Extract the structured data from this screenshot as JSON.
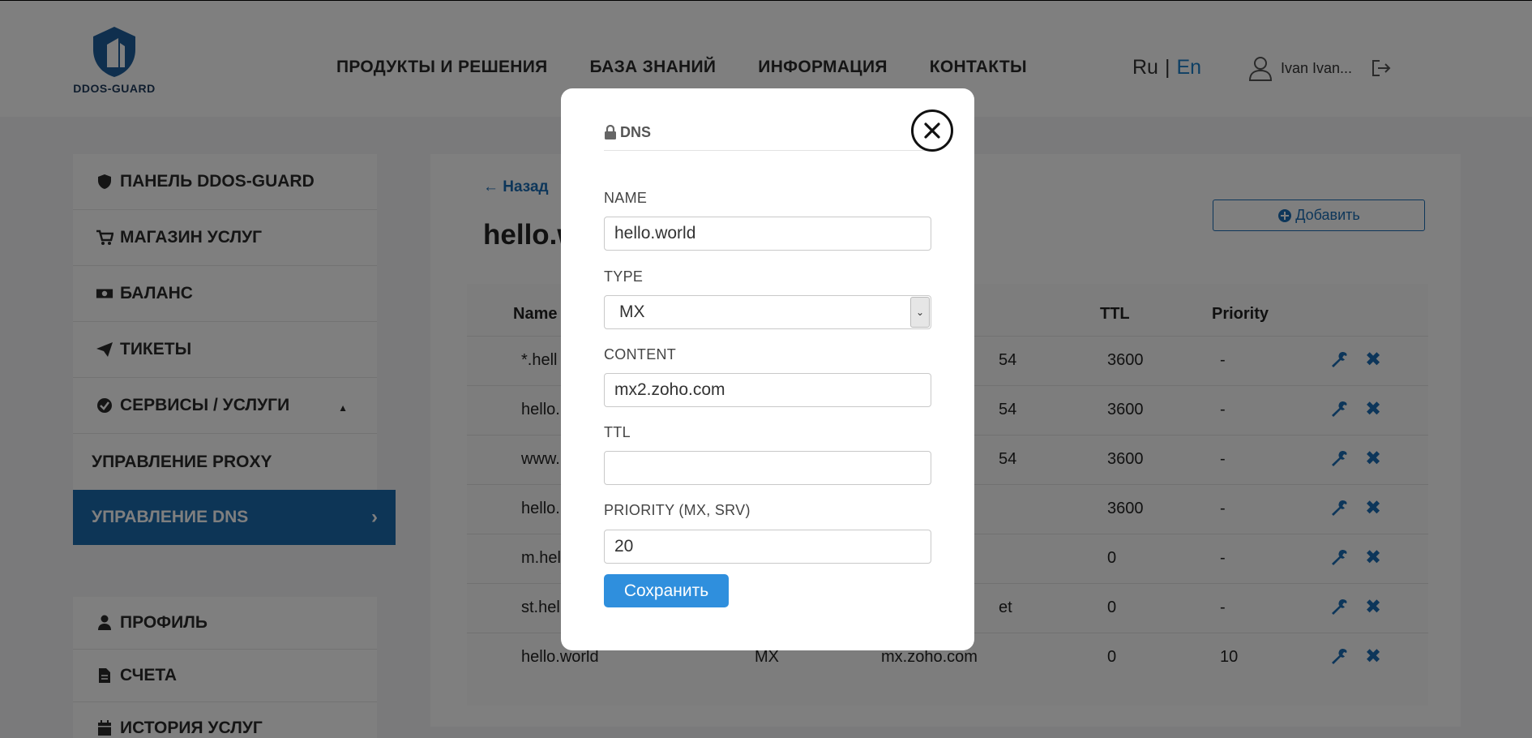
{
  "header": {
    "logo_text": "DDOS-GUARD",
    "nav": [
      {
        "label": "ПРОДУКТЫ И РЕШЕНИЯ"
      },
      {
        "label": "БАЗА ЗНАНИЙ"
      },
      {
        "label": "ИНФОРМАЦИЯ"
      },
      {
        "label": "КОНТАКТЫ"
      }
    ],
    "lang_ru": "Ru",
    "lang_sep": "|",
    "lang_en": "En",
    "user_name": "Ivan Ivan..."
  },
  "sidebar": {
    "items": [
      {
        "label": "ПАНЕЛЬ DDOS-GUARD",
        "icon": "shield-icon"
      },
      {
        "label": "МАГАЗИН УСЛУГ",
        "icon": "cart-icon"
      },
      {
        "label": "БАЛАНС",
        "icon": "money-icon"
      },
      {
        "label": "ТИКЕТЫ",
        "icon": "paper-plane-icon"
      },
      {
        "label": "СЕРВИСЫ / УСЛУГИ",
        "icon": "check-circle-icon"
      }
    ],
    "sub_proxy": "УПРАВЛЕНИЕ PROXY",
    "sub_dns": "УПРАВЛЕНИЕ DNS",
    "bottom_items": [
      {
        "label": "ПРОФИЛЬ",
        "icon": "user-icon"
      },
      {
        "label": "СЧЕТА",
        "icon": "file-icon"
      },
      {
        "label": "ИСТОРИЯ УСЛУГ",
        "icon": "calendar-icon"
      }
    ]
  },
  "main": {
    "back_label": "← Назад",
    "title": "hello.w",
    "add_label": "Добавить",
    "columns": {
      "name": "Name",
      "ttl": "TTL",
      "priority": "Priority"
    },
    "rows": [
      {
        "name": "*.hell",
        "type": "",
        "content": "54",
        "ttl": "3600",
        "priority": "-"
      },
      {
        "name": "hello.",
        "type": "",
        "content": "54",
        "ttl": "3600",
        "priority": "-"
      },
      {
        "name": "www.",
        "type": "",
        "content": "54",
        "ttl": "3600",
        "priority": "-"
      },
      {
        "name": "hello.",
        "type": "",
        "content": "",
        "ttl": "3600",
        "priority": "-"
      },
      {
        "name": "m.hel",
        "type": "",
        "content": "",
        "ttl": "0",
        "priority": "-"
      },
      {
        "name": "st.hel",
        "type": "",
        "content": "et",
        "ttl": "0",
        "priority": "-"
      },
      {
        "name": "hello.world",
        "type": "MX",
        "content": "mx.zoho.com",
        "ttl": "0",
        "priority": "10"
      }
    ]
  },
  "modal": {
    "title": "DNS",
    "name_label": "NAME",
    "name_value": "hello.world",
    "type_label": "TYPE",
    "type_value": "MX",
    "content_label": "CONTENT",
    "content_value": "mx2.zoho.com",
    "ttl_label": "TTL",
    "ttl_value": "",
    "priority_label": "PRIORITY (MX, SRV)",
    "priority_value": "20",
    "save_label": "Сохранить"
  },
  "colors": {
    "accent": "#1b6aad",
    "button": "#2f8fdd",
    "overlay": "rgba(0,0,0,0.5)"
  }
}
